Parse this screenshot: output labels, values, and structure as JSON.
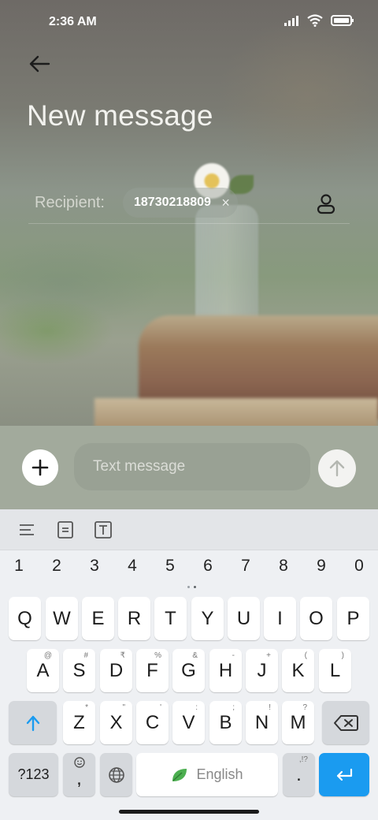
{
  "status_bar": {
    "time": "2:36 AM",
    "icons": [
      "signal-icon",
      "wifi-icon",
      "battery-icon"
    ]
  },
  "header": {
    "title": "New message",
    "back_icon": "back-arrow-icon"
  },
  "recipient": {
    "label": "Recipient:",
    "chip_number": "18730218809",
    "chip_remove": "×",
    "contact_icon": "contact-picker-icon"
  },
  "compose": {
    "placeholder": "Text message",
    "add_icon": "plus-icon",
    "send_icon": "send-arrow-icon"
  },
  "keyboard": {
    "toolbar_icons": [
      "menu-lines-icon",
      "clipboard-icon",
      "text-box-icon"
    ],
    "numbers": [
      "1",
      "2",
      "3",
      "4",
      "5",
      "6",
      "7",
      "8",
      "9",
      "0"
    ],
    "row1": [
      "Q",
      "W",
      "E",
      "R",
      "T",
      "Y",
      "U",
      "I",
      "O",
      "P"
    ],
    "row2": [
      "A",
      "S",
      "D",
      "F",
      "G",
      "H",
      "J",
      "K",
      "L"
    ],
    "row2_hints": [
      "@",
      "#",
      "₹",
      "%",
      "&",
      "-",
      "+",
      "(",
      ")"
    ],
    "row3": [
      "Z",
      "X",
      "C",
      "V",
      "B",
      "N",
      "M"
    ],
    "row3_hints": [
      "*",
      "\"",
      "'",
      ":",
      ";",
      "!",
      "?"
    ],
    "symbols_label": "?123",
    "comma": ",",
    "space_label": "English",
    "period": ".",
    "period_hint": ",!?",
    "accent_color": "#1a9bf0"
  }
}
